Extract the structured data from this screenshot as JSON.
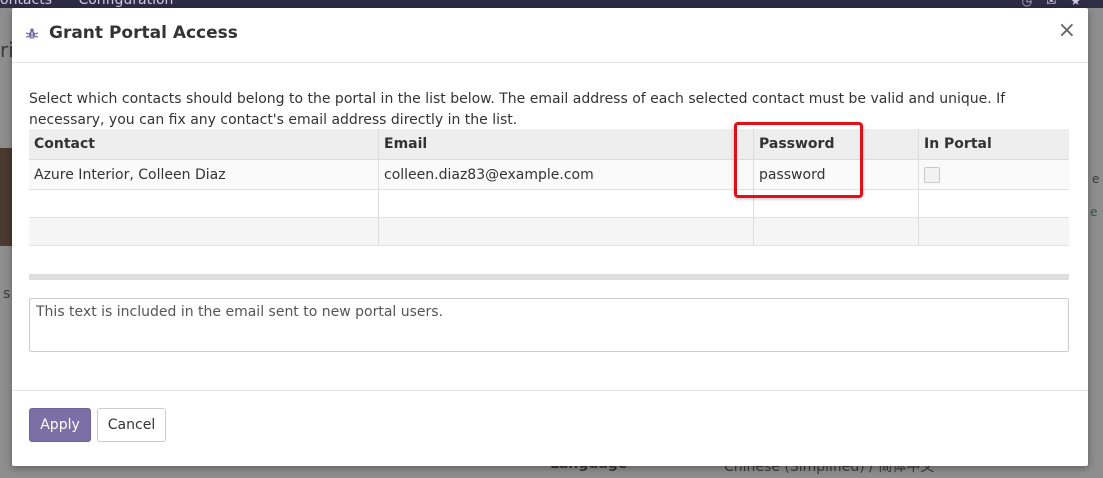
{
  "background": {
    "menu": [
      "ontacts",
      "Configuration"
    ],
    "left_fragment": "ric",
    "left_t": "s T",
    "right_e": "e",
    "right_link": "e",
    "language_label": "Language",
    "language_value": "Chinese (Simplified) / 简体中文"
  },
  "dialog": {
    "title": "Grant Portal Access",
    "close_label": "×",
    "intro": "Select which contacts should belong to the portal in the list below. The email address of each selected contact must be valid and unique. If necessary, you can fix any contact's email address directly in the list.",
    "columns": [
      "Contact",
      "Email",
      "Password",
      "In Portal"
    ],
    "rows": [
      {
        "contact": "Azure Interior, Colleen Diaz",
        "email": "colleen.diaz83@example.com",
        "password": "password",
        "in_portal": false
      }
    ],
    "welcome_placeholder": "This text is included in the email sent to new portal users.",
    "apply_label": "Apply",
    "cancel_label": "Cancel"
  },
  "colors": {
    "primary": "#7c6fa6",
    "highlight": "#e0101a"
  }
}
